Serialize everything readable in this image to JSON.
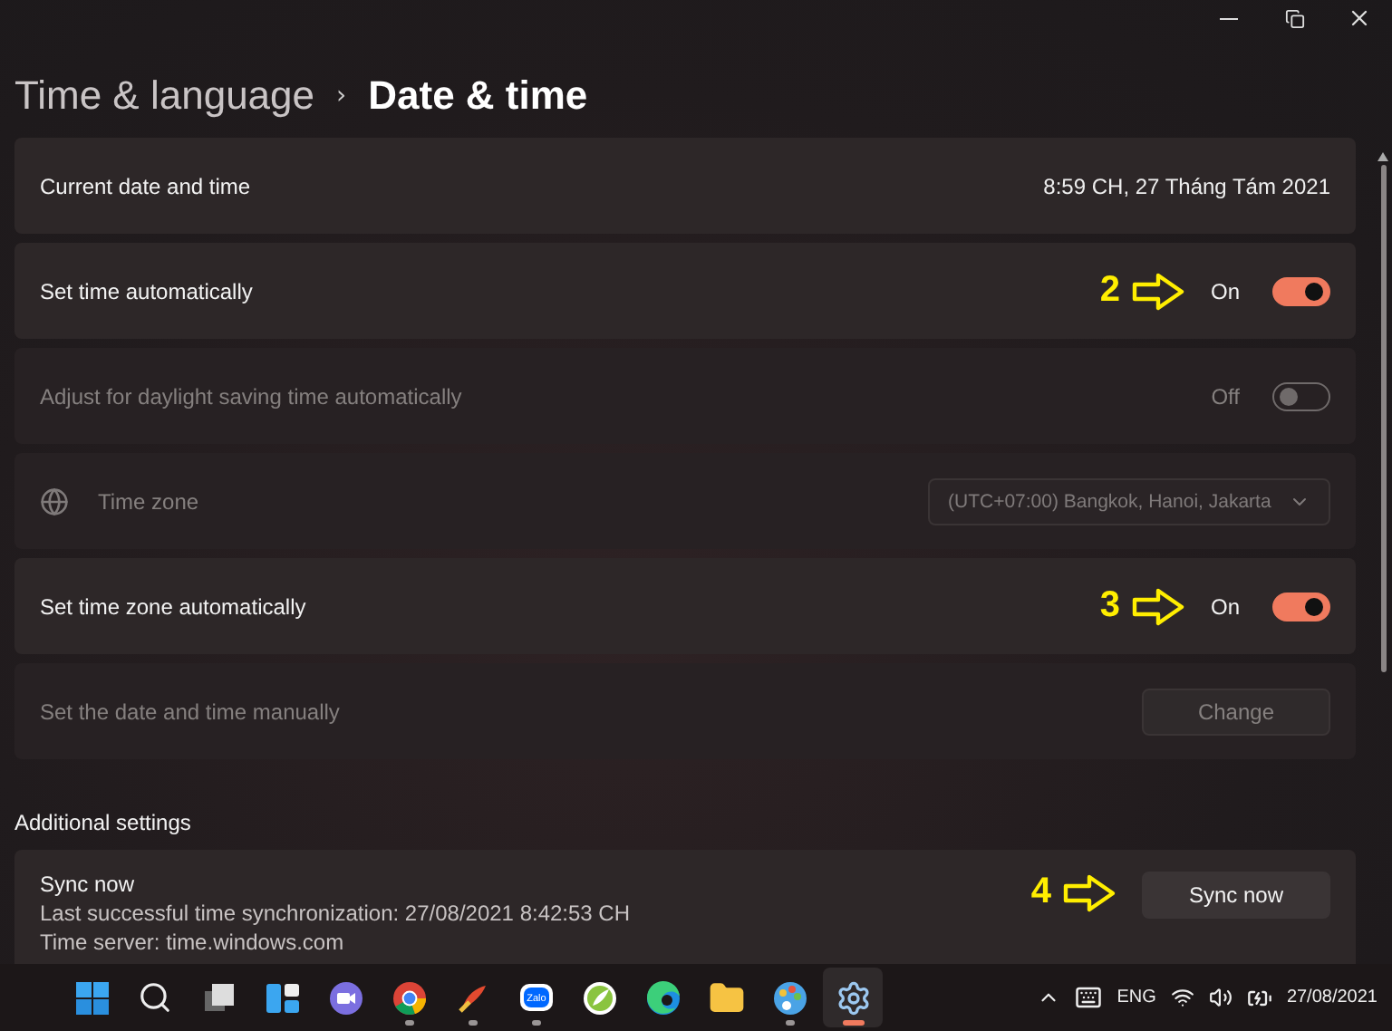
{
  "breadcrumb": {
    "parent": "Time & language",
    "separator": "›",
    "current": "Date & time"
  },
  "rows": [
    {
      "kind": "value",
      "label": "Current date and time",
      "value": "8:59 CH, 27 Tháng Tám 2021",
      "disabled": false
    },
    {
      "kind": "toggle",
      "label": "Set time automatically",
      "state_label": "On",
      "on": true,
      "disabled": false,
      "marker": "2"
    },
    {
      "kind": "toggle",
      "label": "Adjust for daylight saving time automatically",
      "state_label": "Off",
      "on": false,
      "disabled": true
    },
    {
      "kind": "dropdown",
      "label": "Time zone",
      "value": "(UTC+07:00) Bangkok, Hanoi, Jakarta",
      "disabled": true
    },
    {
      "kind": "toggle",
      "label": "Set time zone automatically",
      "state_label": "On",
      "on": true,
      "disabled": false,
      "marker": "3"
    },
    {
      "kind": "button",
      "label": "Set the date and time manually",
      "button": "Change",
      "disabled": true
    }
  ],
  "additional": {
    "heading": "Additional settings",
    "sync": {
      "title": "Sync now",
      "lines": [
        "Last successful time synchronization: 27/08/2021 8:42:53 CH",
        "Time server: time.windows.com"
      ],
      "button": "Sync now",
      "marker": "4"
    }
  },
  "taskbar": {
    "apps": [
      {
        "kind": "start",
        "running": false,
        "selected": false
      },
      {
        "kind": "search",
        "running": false,
        "selected": false
      },
      {
        "kind": "taskview",
        "running": false,
        "selected": false
      },
      {
        "kind": "widgets",
        "running": false,
        "selected": false
      },
      {
        "kind": "chat",
        "running": false,
        "selected": false
      },
      {
        "kind": "chrome",
        "running": true,
        "selected": false
      },
      {
        "kind": "broom",
        "running": true,
        "selected": false
      },
      {
        "kind": "zalo",
        "running": true,
        "selected": false,
        "label": "Zalo"
      },
      {
        "kind": "leaf",
        "running": false,
        "selected": false
      },
      {
        "kind": "edge",
        "running": false,
        "selected": false
      },
      {
        "kind": "folder",
        "running": false,
        "selected": false
      },
      {
        "kind": "palette",
        "running": true,
        "selected": false
      },
      {
        "kind": "settings",
        "running": true,
        "selected": true
      }
    ],
    "tray": {
      "language": "ENG",
      "date": "27/08/2021"
    }
  }
}
